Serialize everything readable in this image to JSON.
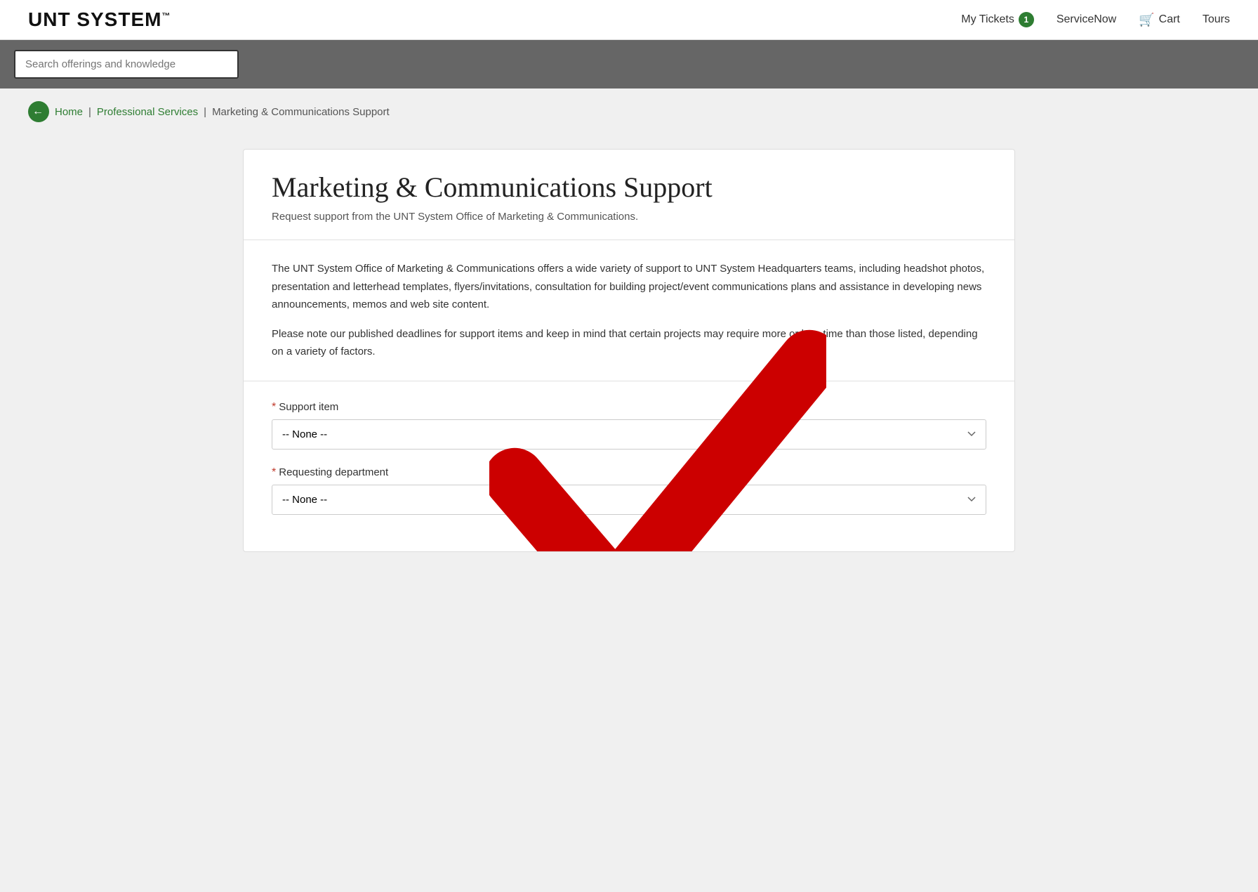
{
  "header": {
    "logo": "UNT SYSTEM",
    "logo_tm": "™",
    "nav": {
      "my_tickets_label": "My Tickets",
      "my_tickets_count": "1",
      "service_now_label": "ServiceNow",
      "cart_label": "Cart",
      "tours_label": "Tours"
    }
  },
  "search": {
    "placeholder": "Search offerings and knowledge"
  },
  "breadcrumb": {
    "home_label": "Home",
    "separator1": "|",
    "professional_services_label": "Professional Services",
    "separator2": "|",
    "current_label": "Marketing & Communications Support"
  },
  "card": {
    "title": "Marketing & Communications Support",
    "subtitle": "Request support from the UNT System Office of Marketing & Communications.",
    "description_p1": "The UNT System Office of Marketing & Communications offers a wide variety of support to UNT System Headquarters teams, including headshot photos, presentation and letterhead templates, flyers/invitations, consultation for building project/event communications plans and assistance in developing news announcements, memos and web site content.",
    "description_p2": "Please note our published deadlines for support items and keep in mind that certain projects may require more or less time than those listed, depending on a variety of factors."
  },
  "form": {
    "support_item_label": "Support item",
    "support_item_placeholder": "-- None --",
    "requesting_dept_label": "Requesting department",
    "requesting_dept_placeholder": "-- None --"
  },
  "colors": {
    "green": "#2e7d32",
    "red": "#cc0000",
    "dark_gray": "#666",
    "border": "#ccc"
  }
}
